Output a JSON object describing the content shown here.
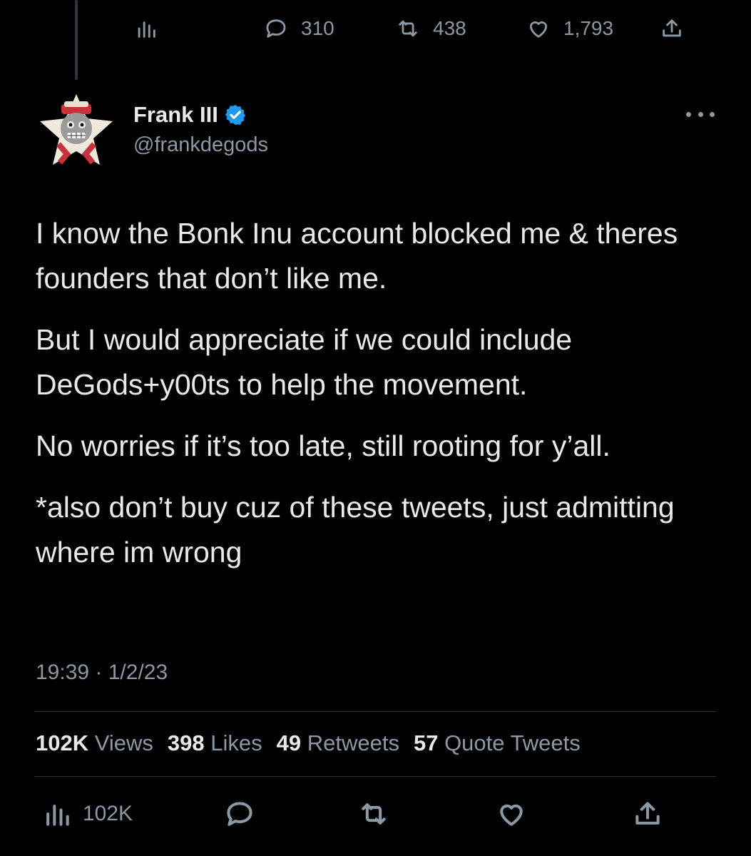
{
  "top_actions": {
    "replies": "310",
    "retweets": "438",
    "likes": "1,793"
  },
  "author": {
    "name": "Frank III",
    "handle": "@frankdegods"
  },
  "tweet": {
    "paragraphs": [
      "I know the Bonk Inu account blocked me & theres founders that don’t like me.",
      "But I would appreciate if we could include DeGods+y00ts to help the movement.",
      "No worries if it’s too late, still rooting for y’all.",
      "*also don’t buy cuz of these tweets, just admitting where im wrong"
    ],
    "timestamp": "19:39 · 1/2/23"
  },
  "stats": {
    "views_count": "102K",
    "views_label": "Views",
    "likes_count": "398",
    "likes_label": "Likes",
    "retweets_count": "49",
    "retweets_label": "Retweets",
    "quotes_count": "57",
    "quotes_label": "Quote Tweets"
  },
  "bottom_actions": {
    "views": "102K"
  },
  "colors": {
    "background": "#000000",
    "text": "#e7e9ea",
    "secondary": "#8b98a5",
    "verified": "#1d9bf0",
    "divider": "#2f3336"
  }
}
